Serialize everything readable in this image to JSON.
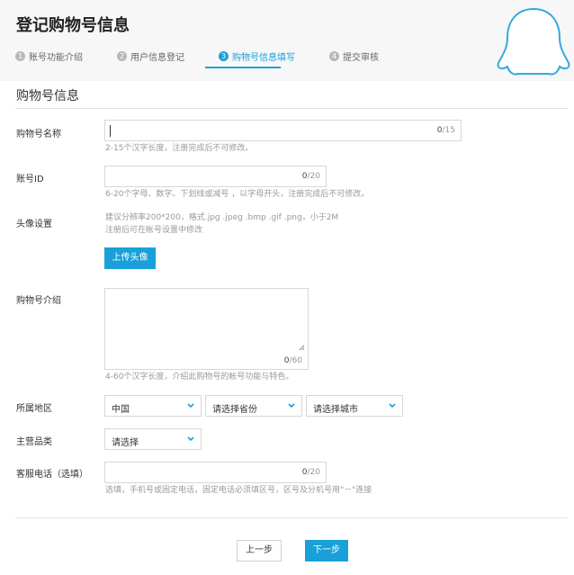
{
  "header": {
    "title": "登记购物号信息",
    "steps": [
      {
        "num": "1",
        "label": "账号功能介绍"
      },
      {
        "num": "2",
        "label": "用户信息登记"
      },
      {
        "num": "3",
        "label": "购物号信息填写"
      },
      {
        "num": "4",
        "label": "提交审核"
      }
    ],
    "active_step": 3
  },
  "section": {
    "title": "购物号信息"
  },
  "form": {
    "name": {
      "label": "购物号名称",
      "value": "",
      "count": "0",
      "max": "/15",
      "hint": "2-15个汉字长度，注册完成后不可修改。"
    },
    "account_id": {
      "label": "账号ID",
      "value": "",
      "count": "0",
      "max": "/20",
      "hint": "6-20个字母、数字、下划线或减号 ，以字母开头，注册完成后不可修改。"
    },
    "avatar": {
      "label": "头像设置",
      "hint_line1": "建议分辨率200*200，格式.jpg .jpeg .bmp .gif .png，小于2M",
      "hint_line2": "注册后可在帐号设置中修改",
      "upload_label": "上传头像"
    },
    "intro": {
      "label": "购物号介绍",
      "value": "",
      "count": "0",
      "max": "/60",
      "hint": "4-60个汉字长度，介绍此购物号的帐号功能与特色。"
    },
    "region": {
      "label": "所属地区",
      "country": "中国",
      "province": "请选择省份",
      "city": "请选择城市"
    },
    "category": {
      "label": "主营品类",
      "value": "请选择"
    },
    "phone": {
      "label": "客服电话（选填）",
      "value": "",
      "count": "0",
      "max": "/20",
      "hint": "选填，手机号或固定电话，固定电话必须填区号，区号及分机号用\"－\"连接"
    }
  },
  "footer": {
    "prev_label": "上一步",
    "next_label": "下一步"
  },
  "colors": {
    "accent": "#1aa0d8",
    "border": "#d7d7d7",
    "hint": "#999999"
  }
}
